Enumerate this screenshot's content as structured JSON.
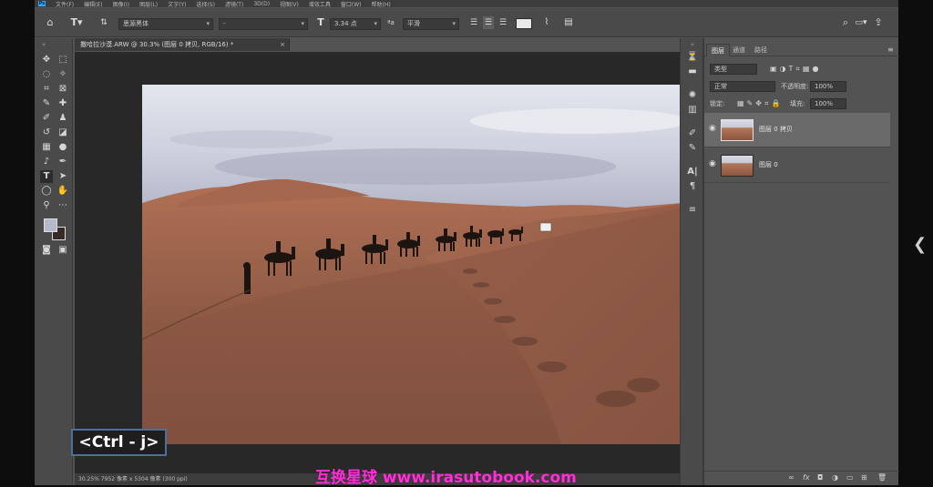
{
  "menubar": {
    "items": [
      "文件(F)",
      "编辑(E)",
      "图像(I)",
      "图层(L)",
      "文字(Y)",
      "选择(S)",
      "滤镜(T)",
      "3D(D)",
      "视图(V)",
      "增效工具",
      "窗口(W)",
      "帮助(H)"
    ]
  },
  "optionsbar": {
    "font_family": "思源黑体",
    "font_style": "-",
    "font_size": "3.34 点",
    "antialias": "平滑",
    "color_swatch": "#e8e8e8"
  },
  "document": {
    "tab_title": "撒哈拉沙漠.ARW @ 30.3% (图层 0 拷贝, RGB/16) *",
    "status": "30.25%    7952 像素 x 5304 像素 (300 ppi)"
  },
  "layers_panel": {
    "tabs": [
      "图层",
      "通道",
      "路径"
    ],
    "filter_kind": "类型",
    "blend_mode": "正常",
    "opacity_label": "不透明度:",
    "opacity_value": "100%",
    "lock_label": "锁定:",
    "fill_label": "填充:",
    "fill_value": "100%",
    "layers": [
      {
        "name": "图层 0 拷贝",
        "active": true
      },
      {
        "name": "图层 0",
        "active": false
      }
    ]
  },
  "overlay": {
    "shortcut": "<Ctrl - j>",
    "watermark": "互换星球 www.irasutobook.com"
  },
  "colors": {
    "foreground": "#b5bac9",
    "background": "#3a2a26",
    "watermark": "#ff2fd6"
  }
}
